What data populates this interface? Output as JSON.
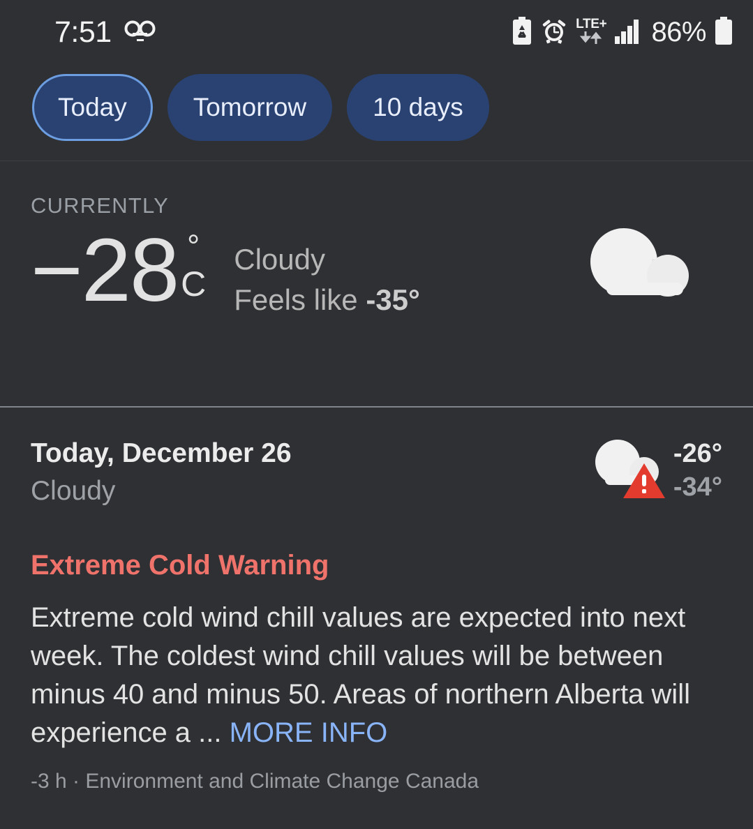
{
  "status_bar": {
    "time": "7:51",
    "voicemail_icon": "voicemail-icon",
    "battery_saver_icon": "battery-saver-icon",
    "alarm_icon": "alarm-clock-icon",
    "network_label": "LTE+",
    "data_arrows_icon": "data-transfer-arrows-icon",
    "signal_icon": "signal-bars-icon",
    "battery_percent": "86%",
    "battery_icon": "battery-full-icon"
  },
  "tabs": [
    {
      "label": "Today",
      "selected": true
    },
    {
      "label": "Tomorrow",
      "selected": false
    },
    {
      "label": "10 days",
      "selected": false
    }
  ],
  "currently": {
    "label": "CURRENTLY",
    "temperature": "−28",
    "degree_symbol": "°",
    "unit": "C",
    "condition": "Cloudy",
    "feels_like_label": "Feels like",
    "feels_like_value": "-35°",
    "icon": "cloudy-icon"
  },
  "day_forecast": {
    "title": "Today, December 26",
    "condition": "Cloudy",
    "icon": "cloudy-icon",
    "warning_icon": "warning-triangle-icon",
    "high": "-26°",
    "low": "-34°"
  },
  "alert": {
    "title": "Extreme Cold Warning",
    "body": "Extreme cold wind chill values are expected into next week. The coldest wind chill values will be between minus 40 and minus 50. Areas of northern Alberta will experience a ... ",
    "more_info_label": "MORE INFO",
    "source": "-3 h · Environment and Climate Change Canada"
  },
  "colors": {
    "background": "#2f3034",
    "chip_fill": "#2a4271",
    "chip_selected_border": "#6b9de0",
    "alert_title": "#f0736b",
    "link": "#8ab4f8",
    "warning_triangle": "#e33b2e"
  }
}
